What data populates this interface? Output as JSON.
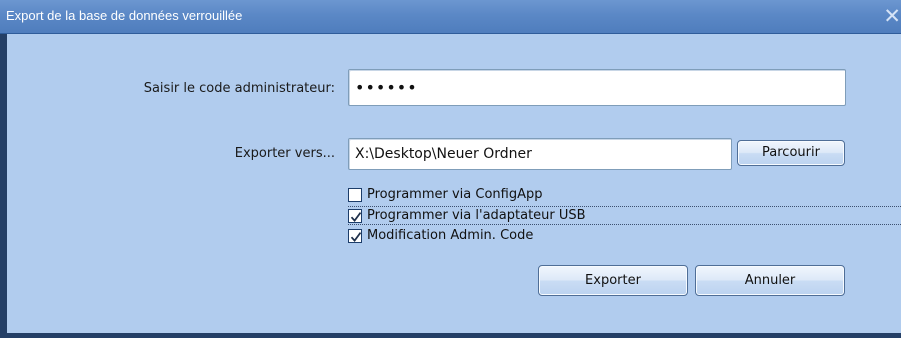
{
  "window": {
    "title": "Export de la base de données verrouillée",
    "close_glyph": "✕"
  },
  "admin_code": {
    "label": "Saisir le code administrateur:",
    "masked_value": "••••••"
  },
  "export": {
    "label": "Exporter vers...",
    "path_value": "X:\\Desktop\\Neuer Ordner",
    "browse_label": "Parcourir"
  },
  "options": [
    {
      "label": "Programmer via ConfigApp",
      "checked": false
    },
    {
      "label": "Programmer via l'adaptateur USB",
      "checked": true
    },
    {
      "label": "Modification Admin. Code",
      "checked": true
    }
  ],
  "actions": {
    "export_label": "Exporter",
    "cancel_label": "Annuler"
  },
  "colors": {
    "titlebar": "#5b88c6",
    "client_background": "#b1ccee",
    "frame": "#243f66"
  }
}
